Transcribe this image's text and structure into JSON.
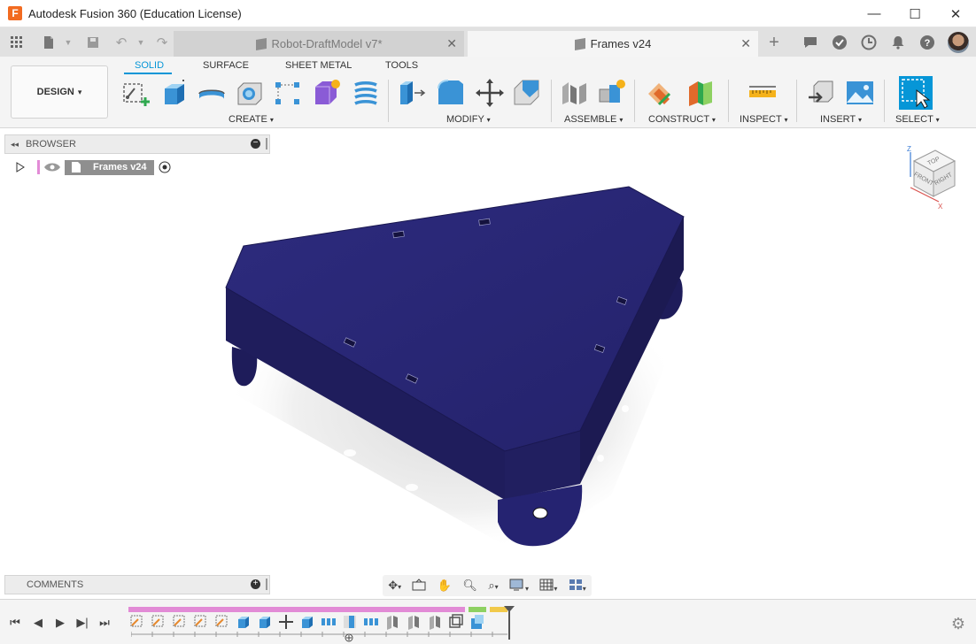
{
  "window": {
    "title": "Autodesk Fusion 360 (Education License)",
    "app_icon_letter": "F",
    "minimize": "—",
    "maximize": "☐",
    "close": "✕"
  },
  "tabs": [
    {
      "label": "Robot-DraftModel v7*",
      "active": false
    },
    {
      "label": "Frames v24",
      "active": true
    }
  ],
  "ribbon": {
    "workspace": "DESIGN",
    "tabs": [
      "SOLID",
      "SURFACE",
      "SHEET METAL",
      "TOOLS"
    ],
    "groups": [
      "CREATE",
      "MODIFY",
      "ASSEMBLE",
      "CONSTRUCT",
      "INSPECT",
      "INSERT",
      "SELECT"
    ],
    "dropdown_glyph": "▾"
  },
  "browser": {
    "title": "BROWSER",
    "root_item": "Frames v24"
  },
  "comments": {
    "title": "COMMENTS"
  },
  "viewcube": {
    "faces": [
      "TOP",
      "FRONT",
      "RIGHT"
    ],
    "axes": [
      "Z",
      "X"
    ]
  },
  "colors": {
    "accent": "#0696d7",
    "model_top": "#2a2877",
    "model_side": "#1e1c5a",
    "timeline_pink": "#e28bd6",
    "timeline_green": "#8ed162",
    "timeline_yellow": "#f1c94a"
  },
  "icons": {
    "grid_menu": "apps-grid-icon",
    "file": "file-icon",
    "save": "save-icon",
    "undo": "undo-icon",
    "redo": "redo-icon",
    "new_tab": "plus-icon",
    "notifications": "bell-icon",
    "help": "help-icon",
    "settings": "gear-icon"
  }
}
